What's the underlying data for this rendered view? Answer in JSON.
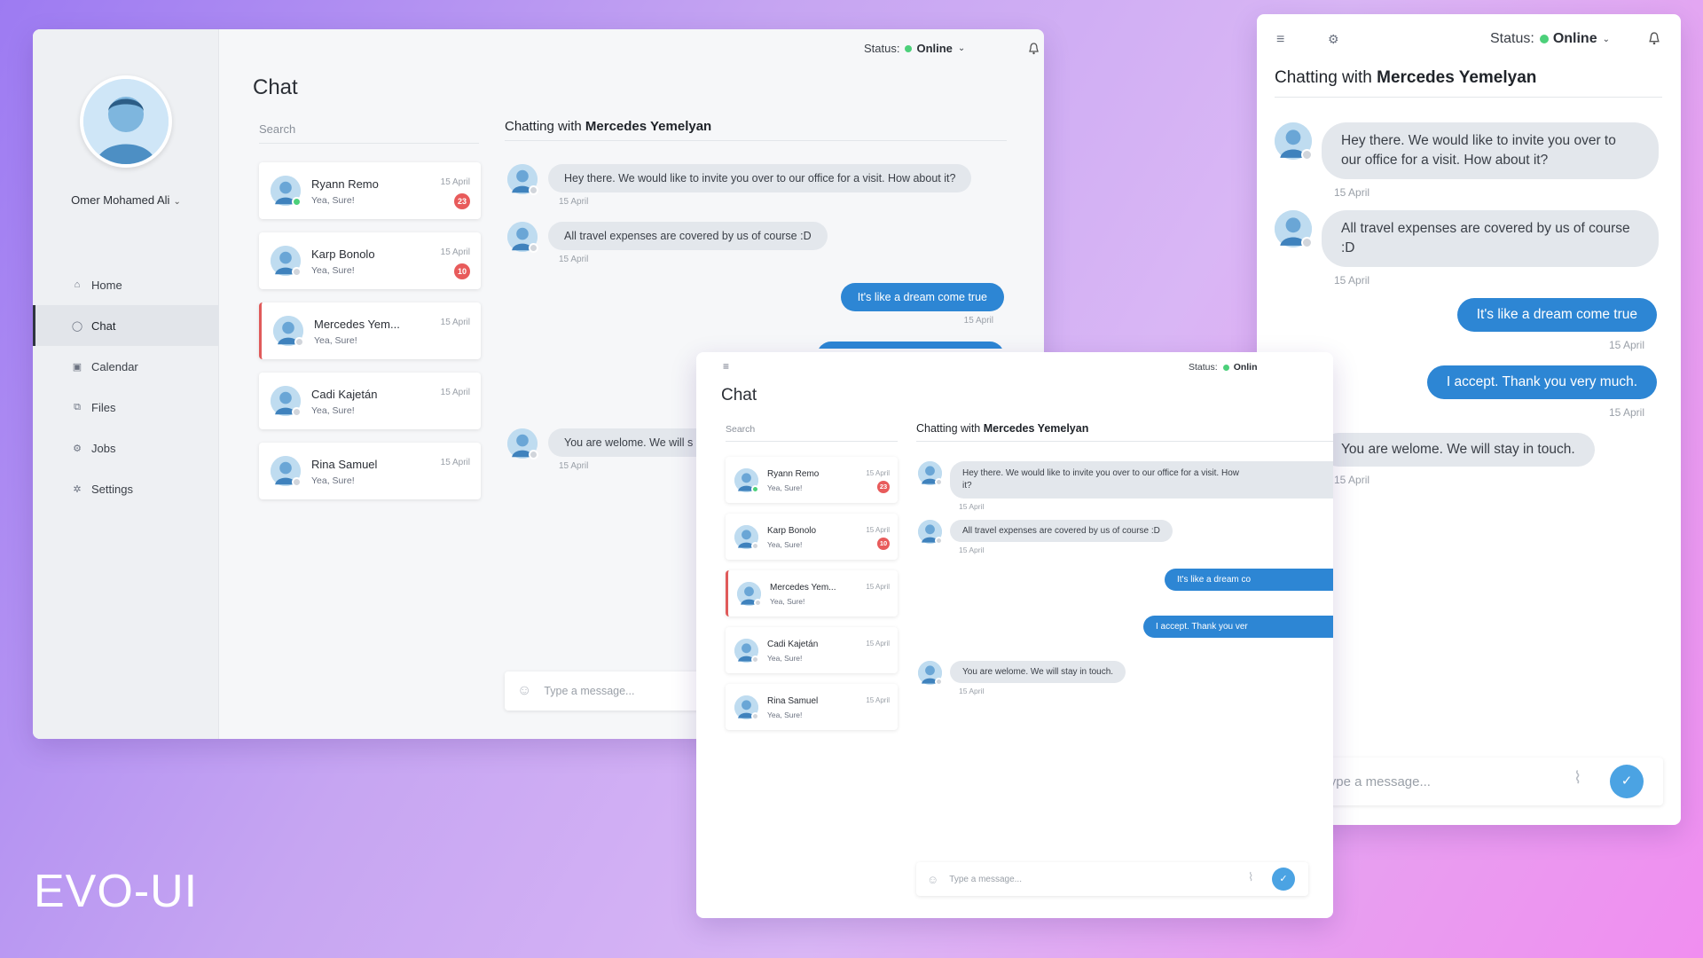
{
  "brand": "EVO-UI",
  "colors": {
    "accent": "#2d86d4",
    "online": "#4cd07a",
    "badge": "#e85b5b",
    "active_marker": "#e05a5a"
  },
  "icons": [
    "home-icon",
    "chat-icon",
    "calendar-icon",
    "files-icon",
    "jobs-icon",
    "settings-icon",
    "bell-icon",
    "menu-icon",
    "smile-icon",
    "attach-icon",
    "send-check-icon",
    "chevron-down-icon",
    "avatar"
  ],
  "user": {
    "name": "Omer Mohamed Ali"
  },
  "nav": [
    {
      "label": "Home",
      "icon": "home-icon"
    },
    {
      "label": "Chat",
      "icon": "chat-icon",
      "active": true
    },
    {
      "label": "Calendar",
      "icon": "calendar-icon"
    },
    {
      "label": "Files",
      "icon": "files-icon"
    },
    {
      "label": "Jobs",
      "icon": "jobs-icon"
    },
    {
      "label": "Settings",
      "icon": "settings-icon"
    }
  ],
  "status": {
    "label": "Status:",
    "value": "Online"
  },
  "page_title": "Chat",
  "search_placeholder": "Search",
  "contacts": [
    {
      "name": "Ryann Remo",
      "preview": "Yea, Sure!",
      "date": "15 April",
      "badge": "23",
      "online": true
    },
    {
      "name": "Karp Bonolo",
      "preview": "Yea, Sure!",
      "date": "15 April",
      "badge": "10",
      "online": false
    },
    {
      "name": "Mercedes Yem...",
      "preview": "Yea, Sure!",
      "date": "15 April",
      "badge": "",
      "online": false,
      "active": true
    },
    {
      "name": "Cadi Kajetán",
      "preview": "Yea, Sure!",
      "date": "15 April",
      "badge": "",
      "online": false
    },
    {
      "name": "Rina Samuel",
      "preview": "Yea, Sure!",
      "date": "15 April",
      "badge": "",
      "online": false
    }
  ],
  "chat": {
    "heading_prefix": "Chatting with",
    "heading_name": "Mercedes Yemelyan",
    "messages": [
      {
        "text": "Hey there. We would like to invite you over to our office for a visit. How about it?",
        "date": "15 April",
        "mine": false
      },
      {
        "text": "All travel expenses are covered by us of course :D",
        "date": "15 April",
        "mine": false
      },
      {
        "text": "It's like a dream come true",
        "date": "15 April",
        "mine": true
      },
      {
        "text": "I accept. Thank you very much.",
        "date": "15 April",
        "mine": true
      },
      {
        "text": "You are welome. We will stay in touch.",
        "date": "15 April",
        "mine": false
      }
    ],
    "composer_placeholder": "Type a message..."
  },
  "w1_partial": {
    "msg5": "You are welome. We will s"
  },
  "w2_partial": {
    "status_value": "Onlin",
    "msg1": "Hey there. We would like to invite you over to our office for a visit. How",
    "msg1b": "it?",
    "msg3": "It's like a dream co",
    "msg4": "I accept. Thank you ver"
  },
  "w3_wrapped": {
    "msg1a": "Hey there. We would like to invite you over to",
    "msg1b": "our office for a visit. How about it?",
    "msg2a": "All travel expenses are covered by us of course",
    "msg2b": ":D"
  }
}
